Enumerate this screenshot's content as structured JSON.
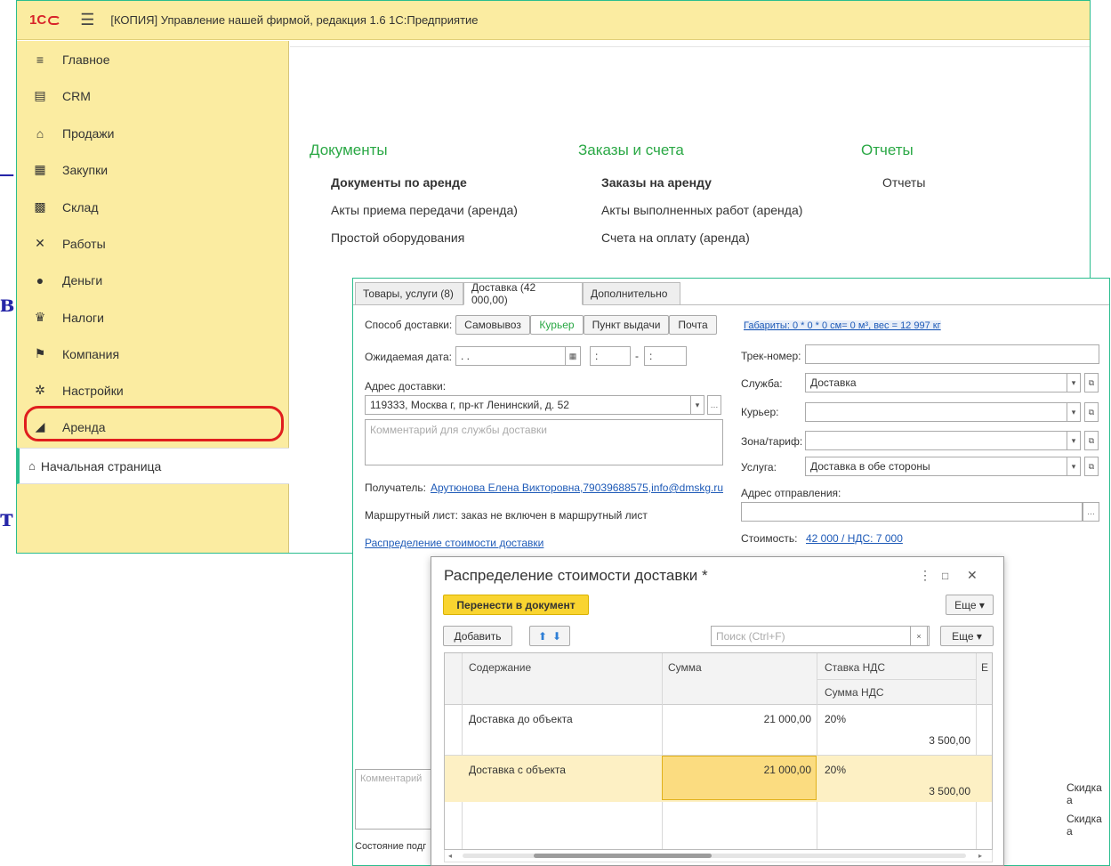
{
  "window": {
    "logo": "1С",
    "title": "[КОПИЯ] Управление нашей фирмой, редакция 1.6 1С:Предприятие"
  },
  "sidebar": {
    "items": [
      {
        "label": "Главное",
        "icon": "hamburger-icon"
      },
      {
        "label": "CRM",
        "icon": "crm-card-icon"
      },
      {
        "label": "Продажи",
        "icon": "basket-icon"
      },
      {
        "label": "Закупки",
        "icon": "cart-icon"
      },
      {
        "label": "Склад",
        "icon": "warehouse-icon"
      },
      {
        "label": "Работы",
        "icon": "tools-icon"
      },
      {
        "label": "Деньги",
        "icon": "ruble-coin-icon"
      },
      {
        "label": "Налоги",
        "icon": "eagle-emblem-icon"
      },
      {
        "label": "Компания",
        "icon": "flag-icon"
      },
      {
        "label": "Настройки",
        "icon": "gear-icon"
      },
      {
        "label": "Аренда",
        "icon": "factory-icon"
      }
    ],
    "home": "Начальная страница"
  },
  "content": {
    "columns": [
      {
        "heading": "Документы",
        "links": [
          "Документы по аренде",
          "Акты приема передачи (аренда)",
          "Простой оборудования"
        ]
      },
      {
        "heading": "Заказы и счета",
        "links": [
          "Заказы на аренду",
          "Акты выполненных работ (аренда)",
          "Счета на оплату (аренда)"
        ]
      },
      {
        "heading": "Отчеты",
        "links": [
          "Отчеты"
        ]
      }
    ]
  },
  "order": {
    "tabs": [
      "Товары, услуги (8)",
      "Доставка (42 000,00)",
      "Дополнительно"
    ],
    "delivery_method_label": "Способ доставки:",
    "delivery_methods": [
      "Самовывоз",
      "Курьер",
      "Пункт выдачи",
      "Почта"
    ],
    "dimensions_link": "Габариты: 0 * 0 * 0 см= 0 м³, вес = 12 997 кг",
    "expected_date_label": "Ожидаемая дата:",
    "expected_date_value": " .  .",
    "time_from": " :",
    "time_to": " :",
    "track_label": "Трек-номер:",
    "track_value": "",
    "address_label": "Адрес доставки:",
    "address_value": "119333, Москва г, пр-кт Ленинский, д. 52",
    "service_label": "Служба:",
    "service_value": "Доставка",
    "courier_label": "Курьер:",
    "courier_value": "",
    "zone_label": "Зона/тариф:",
    "zone_value": "",
    "comment_placeholder": "Комментарий для службы доставки",
    "service2_label": "Услуга:",
    "service2_value": "Доставка в обе стороны",
    "recipient_label": "Получатель:",
    "recipient_value": "Арутюнова Елена Викторовна,79039688575,info@dmskg.ru",
    "departure_label": "Адрес отправления:",
    "route_text": "Маршрутный лист: заказ не включен в маршрутный лист",
    "cost_label": "Стоимость:",
    "cost_value": "42 000 / НДС: 7 000",
    "distribution_link": "Распределение стоимости доставки",
    "comment2_placeholder": "Комментарий",
    "discount1": "Скидка а",
    "discount2": "Скидка а",
    "status_text": "Состояние подг"
  },
  "dialog": {
    "title": "Распределение стоимости доставки *",
    "more_icon": "⋮",
    "maximize_icon": "□",
    "close_icon": "✕",
    "transfer_button": "Перенести в документ",
    "more1": "Еще ▾",
    "add_button": "Добавить",
    "search_placeholder": "Поиск (Ctrl+F)",
    "clear": "×",
    "more2": "Еще ▾",
    "columns": [
      "Содержание",
      "Сумма",
      "Ставка НДС",
      "Сумма НДС",
      "Е"
    ],
    "rows": [
      {
        "content": "Доставка до объекта",
        "sum": "21 000,00",
        "vat_rate": "20%",
        "vat_sum": "3 500,00"
      },
      {
        "content": "Доставка с объекта",
        "sum": "21 000,00",
        "vat_rate": "20%",
        "vat_sum": "3 500,00"
      }
    ],
    "selected_row": 1
  },
  "colors": {
    "sidebar_bg": "#fbeca1",
    "accent_green": "#2aa845",
    "highlight_red": "#e01e1e",
    "button_yellow": "#f9d430",
    "row_selected": "#fdf0c4",
    "cell_selected": "#fbdc80"
  }
}
